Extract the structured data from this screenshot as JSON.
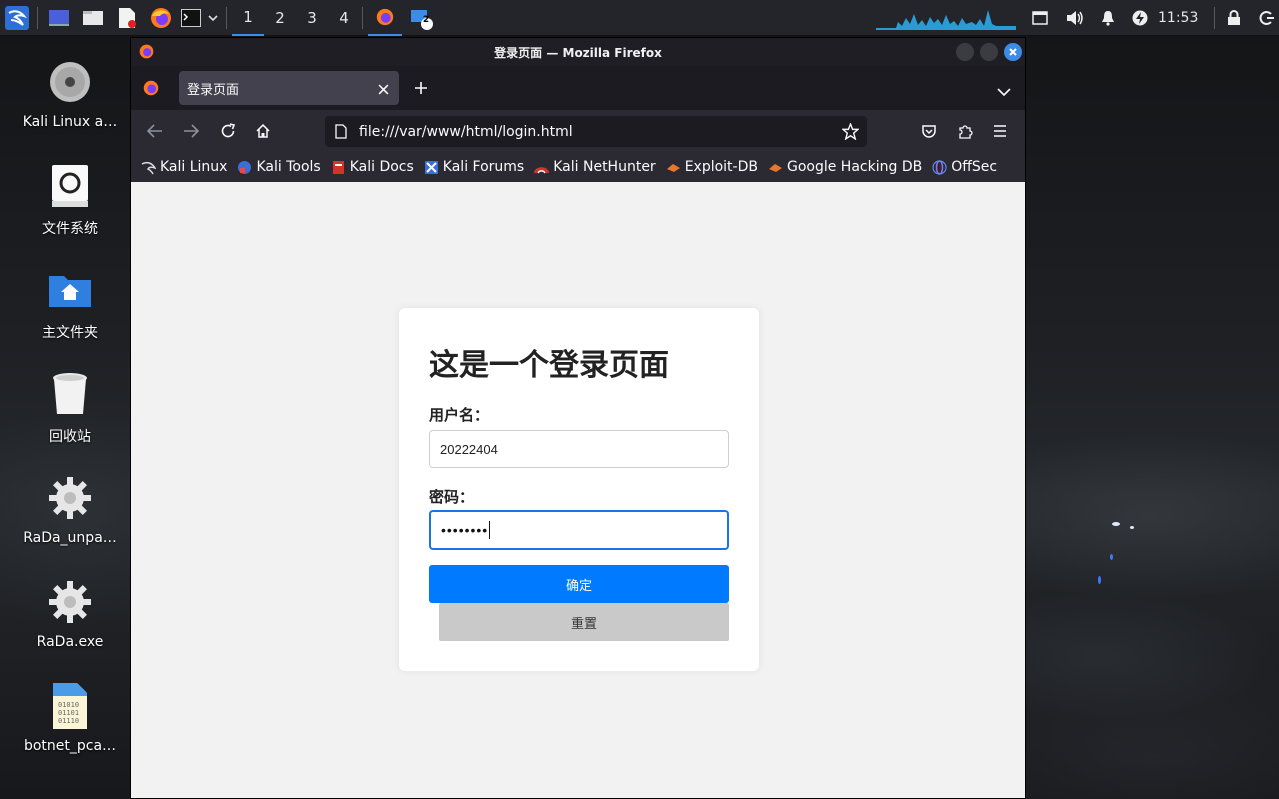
{
  "panel": {
    "workspaces": [
      "1",
      "2",
      "3",
      "4"
    ],
    "active_workspace": "1",
    "file_manager_badge": "2",
    "clock": "11:53"
  },
  "desktop": {
    "icons": [
      {
        "label": "Kali Linux a…",
        "icon": "disc-icon"
      },
      {
        "label": "文件系统",
        "icon": "drive-icon"
      },
      {
        "label": "主文件夹",
        "icon": "home-folder-icon"
      },
      {
        "label": "回收站",
        "icon": "trash-icon"
      },
      {
        "label": "RaDa_unpa…",
        "icon": "gear-icon"
      },
      {
        "label": "RaDa.exe",
        "icon": "gear-icon"
      },
      {
        "label": "botnet_pca…",
        "icon": "binary-file-icon"
      }
    ]
  },
  "browser": {
    "window_title": "登录页面 — Mozilla Firefox",
    "tab_title": "登录页面",
    "url": "file:///var/www/html/login.html",
    "bookmarks": [
      "Kali Linux",
      "Kali Tools",
      "Kali Docs",
      "Kali Forums",
      "Kali NetHunter",
      "Exploit-DB",
      "Google Hacking DB",
      "OffSec"
    ]
  },
  "page": {
    "heading": "这是一个登录页面",
    "username_label": "用户名：",
    "username_value": "20222404",
    "password_label": "密码：",
    "password_mask": "••••••••",
    "submit_label": "确定",
    "reset_label": "重置"
  },
  "colors": {
    "accent": "#007bff",
    "focus": "#1a73e8",
    "reset": "#c9c9c9"
  }
}
